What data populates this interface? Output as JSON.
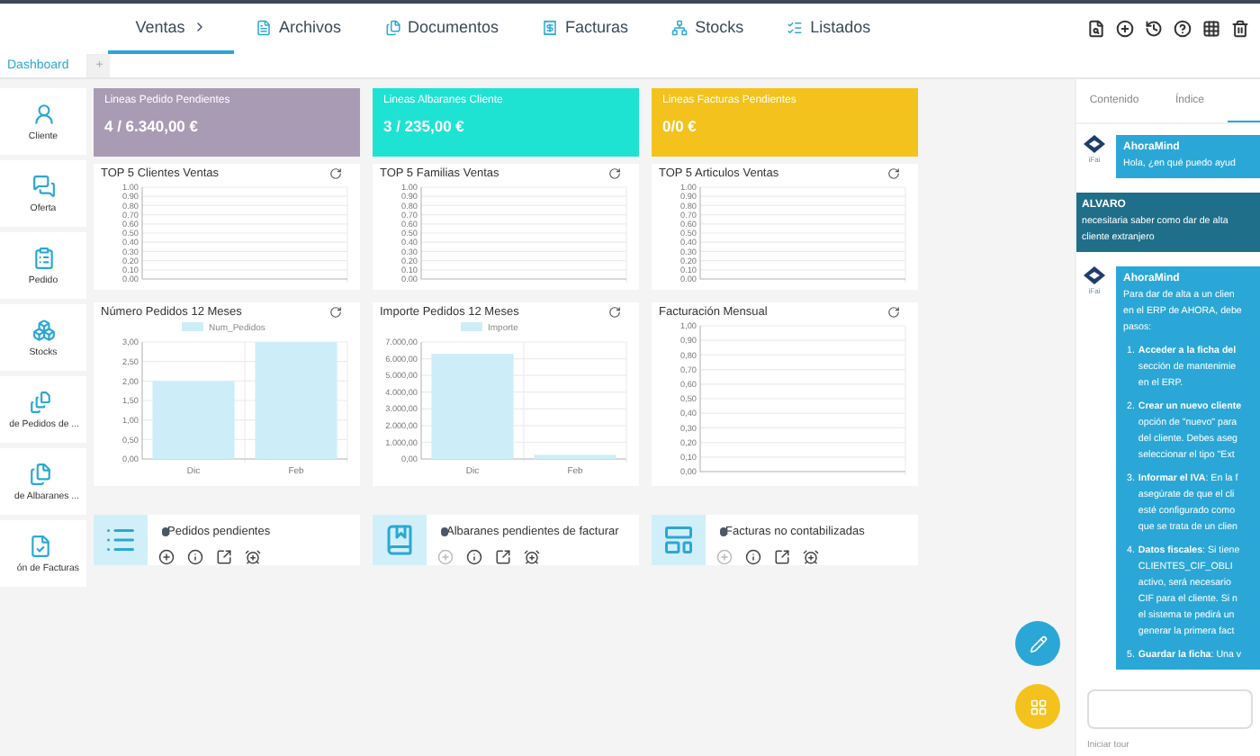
{
  "nav": {
    "tabs": [
      {
        "label": "Ventas",
        "selected": true
      },
      {
        "label": "Archivos",
        "selected": false
      },
      {
        "label": "Documentos",
        "selected": false
      },
      {
        "label": "Facturas",
        "selected": false
      },
      {
        "label": "Stocks",
        "selected": false
      },
      {
        "label": "Listados",
        "selected": false
      }
    ]
  },
  "page_tabs": {
    "tabs": [
      {
        "label": "Dashboard",
        "selected": true
      }
    ],
    "add": "+"
  },
  "sidebar": {
    "items": [
      "Cliente",
      "Oferta",
      "Pedido",
      "Stocks",
      "de Pedidos de ...",
      "de Albaranes ...",
      "ón de Facturas"
    ]
  },
  "kpis": [
    {
      "title": "Lineas Pedido Pendientes",
      "value": "4 / 6.340,00 €",
      "color": "#a99bb4"
    },
    {
      "title": "Lineas Albaranes Cliente",
      "value": "3 / 235,00 €",
      "color": "#1ee3d3"
    },
    {
      "title": "Lineas Facturas Pendientes",
      "value": "0/0 €",
      "color": "#f4c21d"
    }
  ],
  "charts": [
    {
      "chart_data": {
        "type": "bar",
        "grid": true,
        "categories": [
          null
        ],
        "title": "TOP 5 Clientes Ventas",
        "ylim": [
          0,
          1
        ],
        "yticks": [
          {
            "value": 0,
            "label": "0.00"
          },
          {
            "value": 0.1,
            "label": "0.10"
          },
          {
            "value": 0.2,
            "label": "0.20"
          },
          {
            "value": 0.3,
            "label": "0.30"
          },
          {
            "value": 0.4,
            "label": "0.40"
          },
          {
            "value": 0.5,
            "label": "0.50"
          },
          {
            "value": 0.6,
            "label": "0.60"
          },
          {
            "value": 0.7,
            "label": "0.70"
          },
          {
            "value": 0.8,
            "label": "0.80"
          },
          {
            "value": 0.9,
            "label": "0.90"
          },
          {
            "value": 1,
            "label": "1.00"
          }
        ]
      }
    },
    {
      "chart_data": {
        "type": "bar",
        "grid": true,
        "categories": [
          null
        ],
        "title": "TOP 5 Familias Ventas",
        "ylim": [
          0,
          1
        ],
        "yticks": [
          {
            "value": 0,
            "label": "0.00"
          },
          {
            "value": 0.1,
            "label": "0.10"
          },
          {
            "value": 0.2,
            "label": "0.20"
          },
          {
            "value": 0.3,
            "label": "0.30"
          },
          {
            "value": 0.4,
            "label": "0.40"
          },
          {
            "value": 0.5,
            "label": "0.50"
          },
          {
            "value": 0.6,
            "label": "0.60"
          },
          {
            "value": 0.7,
            "label": "0.70"
          },
          {
            "value": 0.8,
            "label": "0.80"
          },
          {
            "value": 0.9,
            "label": "0.90"
          },
          {
            "value": 1,
            "label": "1.00"
          }
        ]
      }
    },
    {
      "chart_data": {
        "type": "bar",
        "grid": true,
        "categories": [
          null
        ],
        "title": "TOP 5 Articulos Ventas",
        "ylim": [
          0,
          1
        ],
        "yticks": [
          {
            "value": 0,
            "label": "0.00"
          },
          {
            "value": 0.1,
            "label": "0.10"
          },
          {
            "value": 0.2,
            "label": "0.20"
          },
          {
            "value": 0.3,
            "label": "0.30"
          },
          {
            "value": 0.4,
            "label": "0.40"
          },
          {
            "value": 0.5,
            "label": "0.50"
          },
          {
            "value": 0.6,
            "label": "0.60"
          },
          {
            "value": 0.7,
            "label": "0.70"
          },
          {
            "value": 0.8,
            "label": "0.80"
          },
          {
            "value": 0.9,
            "label": "0.90"
          },
          {
            "value": 1,
            "label": "1.00"
          }
        ]
      }
    },
    {
      "chart_data": {
        "type": "bar",
        "grid": true,
        "title": "Número Pedidos 12 Meses",
        "categories": [
          "Dic",
          "Feb"
        ],
        "series": [
          {
            "name": "Num_Pedidos",
            "color": "#cdeef8",
            "values": [
              2,
              3
            ]
          }
        ],
        "ylim": [
          0,
          3
        ],
        "yticks": [
          {
            "value": 0,
            "label": "0,00"
          },
          {
            "value": 0.5,
            "label": "0,50"
          },
          {
            "value": 1,
            "label": "1,00"
          },
          {
            "value": 1.5,
            "label": "1,50"
          },
          {
            "value": 2,
            "label": "2,00"
          },
          {
            "value": 2.5,
            "label": "2,50"
          },
          {
            "value": 3,
            "label": "3,00"
          }
        ]
      }
    },
    {
      "chart_data": {
        "type": "bar",
        "grid": true,
        "title": "Importe Pedidos 12 Meses",
        "categories": [
          "Dic",
          "Feb"
        ],
        "series": [
          {
            "name": "Importe",
            "color": "#cdeef8",
            "values": [
              6300,
              250
            ]
          }
        ],
        "ylim": [
          0,
          7000
        ],
        "yticks": [
          {
            "value": 0,
            "label": "0,00"
          },
          {
            "value": 1000,
            "label": "1.000,00"
          },
          {
            "value": 2000,
            "label": "2.000,00"
          },
          {
            "value": 3000,
            "label": "3.000,00"
          },
          {
            "value": 4000,
            "label": "4.000,00"
          },
          {
            "value": 5000,
            "label": "5.000,00"
          },
          {
            "value": 6000,
            "label": "6.000,00"
          },
          {
            "value": 7000,
            "label": "7.000,00"
          }
        ]
      }
    },
    {
      "chart_data": {
        "type": "bar",
        "grid": true,
        "categories": [
          null
        ],
        "title": "Facturación Mensual",
        "ylim": [
          0,
          1
        ],
        "yticks": [
          {
            "value": 0,
            "label": "0,00"
          },
          {
            "value": 0.1,
            "label": "0,10"
          },
          {
            "value": 0.2,
            "label": "0,20"
          },
          {
            "value": 0.3,
            "label": "0,30"
          },
          {
            "value": 0.4,
            "label": "0,40"
          },
          {
            "value": 0.5,
            "label": "0,50"
          },
          {
            "value": 0.6,
            "label": "0,60"
          },
          {
            "value": 0.7,
            "label": "0,70"
          },
          {
            "value": 0.8,
            "label": "0,80"
          },
          {
            "value": 0.9,
            "label": "0,90"
          },
          {
            "value": 1,
            "label": "1,00"
          }
        ]
      }
    }
  ],
  "lists": [
    {
      "title": "Pedidos pendientes",
      "add_disabled": false
    },
    {
      "title": "Albaranes pendientes de facturar",
      "add_disabled": true
    },
    {
      "title": "Facturas no contabilizadas",
      "add_disabled": true
    }
  ],
  "chat": {
    "tabs": [
      {
        "label": "Contenido",
        "selected": false
      },
      {
        "label": "Índice",
        "selected": false
      },
      {
        "selected": true
      }
    ],
    "messages": [
      {
        "kind": "bot",
        "author": "AhoraMind",
        "avatar_label": "iFai",
        "lines": [
          "Hola, ¿en qué puedo ayud"
        ]
      },
      {
        "kind": "user",
        "author": "ALVARO",
        "lines": [
          "necesitaria saber como dar de alta",
          "cliente extranjero"
        ]
      },
      {
        "kind": "bot",
        "author": "AhoraMind",
        "avatar_label": "iFai",
        "lines": [
          "Para dar de alta a un clien",
          "en el ERP de AHORA, debe",
          "pasos:"
        ],
        "steps": [
          {
            "number": "1.",
            "lines": [
              "**Acceder a la ficha del**",
              "sección de mantenimie",
              "en el ERP."
            ]
          },
          {
            "number": "2.",
            "lines": [
              "**Crear un nuevo cliente**",
              "opción de \"nuevo\" para",
              "del cliente. Debes aseg",
              "seleccionar el tipo \"Ext"
            ]
          },
          {
            "number": "3.",
            "lines": [
              "**Informar el IVA**: En la f",
              "asegúrate de que el cli",
              "esté configurado como",
              "que se trata de un clien"
            ]
          },
          {
            "number": "4.",
            "lines": [
              "**Datos fiscales**: Si tiene",
              "CLIENTES_CIF_OBLI",
              "activo, será necesario",
              "CIF para el cliente. Si n",
              "el sistema te pedirá un",
              "generar la primera fact"
            ]
          },
          {
            "number": "5.",
            "lines": [
              "**Guardar la ficha**: Una v"
            ]
          }
        ]
      }
    ],
    "tour_link": "Iniciar tour"
  }
}
